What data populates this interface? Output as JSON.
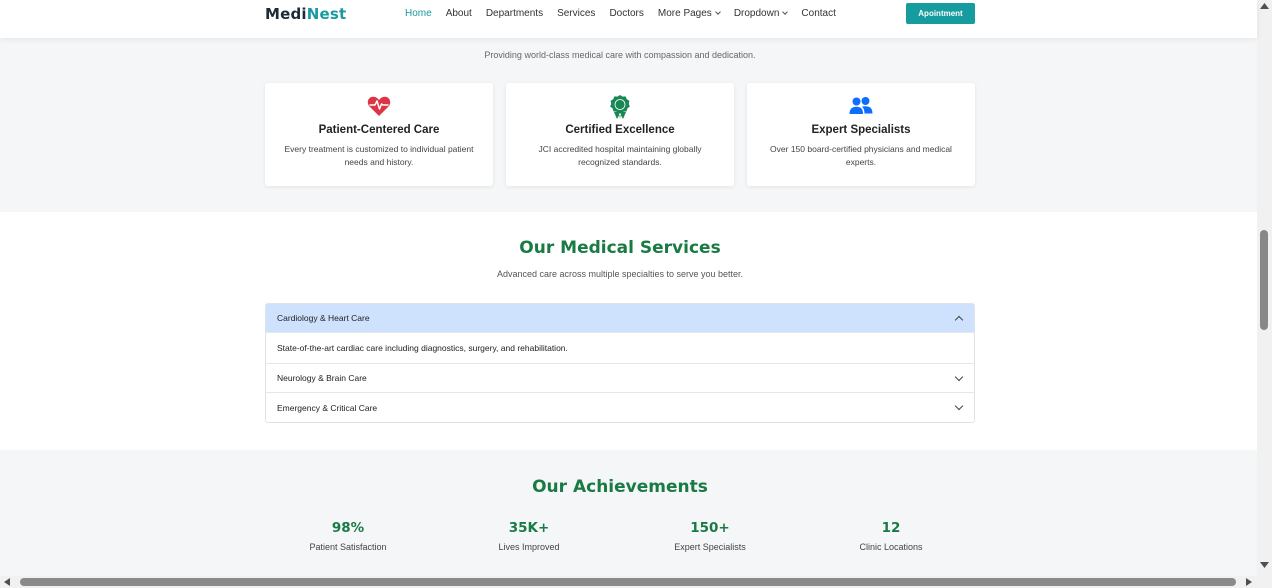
{
  "header": {
    "logo_part1": "Medi",
    "logo_part2": "Nest",
    "nav": [
      {
        "label": "Home",
        "active": true
      },
      {
        "label": "About"
      },
      {
        "label": "Departments"
      },
      {
        "label": "Services"
      },
      {
        "label": "Doctors"
      },
      {
        "label": "More Pages",
        "dropdown": true
      },
      {
        "label": "Dropdown",
        "dropdown": true
      },
      {
        "label": "Contact"
      }
    ],
    "cta": "Apointment"
  },
  "intro": {
    "tagline": "Providing world-class medical care with compassion and dedication.",
    "cards": [
      {
        "icon": "heart-pulse-icon",
        "title": "Patient-Centered Care",
        "desc": "Every treatment is customized to individual patient needs and history."
      },
      {
        "icon": "award-icon",
        "title": "Certified Excellence",
        "desc": "JCI accredited hospital maintaining globally recognized standards."
      },
      {
        "icon": "people-icon",
        "title": "Expert Specialists",
        "desc": "Over 150 board-certified physicians and medical experts."
      }
    ]
  },
  "services": {
    "title": "Our Medical Services",
    "subtitle": "Advanced care across multiple specialties to serve you better.",
    "items": [
      {
        "label": "Cardiology & Heart Care",
        "body": "State-of-the-art cardiac care including diagnostics, surgery, and rehabilitation.",
        "expanded": true
      },
      {
        "label": "Neurology & Brain Care",
        "expanded": false
      },
      {
        "label": "Emergency & Critical Care",
        "expanded": false
      }
    ]
  },
  "achievements": {
    "title": "Our Achievements",
    "stats": [
      {
        "value": "98%",
        "label": "Patient Satisfaction"
      },
      {
        "value": "35K+",
        "label": "Lives Improved"
      },
      {
        "value": "150+",
        "label": "Expert Specialists"
      },
      {
        "value": "12",
        "label": "Clinic Locations"
      }
    ]
  },
  "colors": {
    "brand_teal": "#1a9aa0",
    "heading_green": "#1a7a44",
    "accordion_active": "#cfe2fd",
    "heart_red": "#dc3545",
    "award_green": "#198754",
    "people_blue": "#0d6efd"
  }
}
